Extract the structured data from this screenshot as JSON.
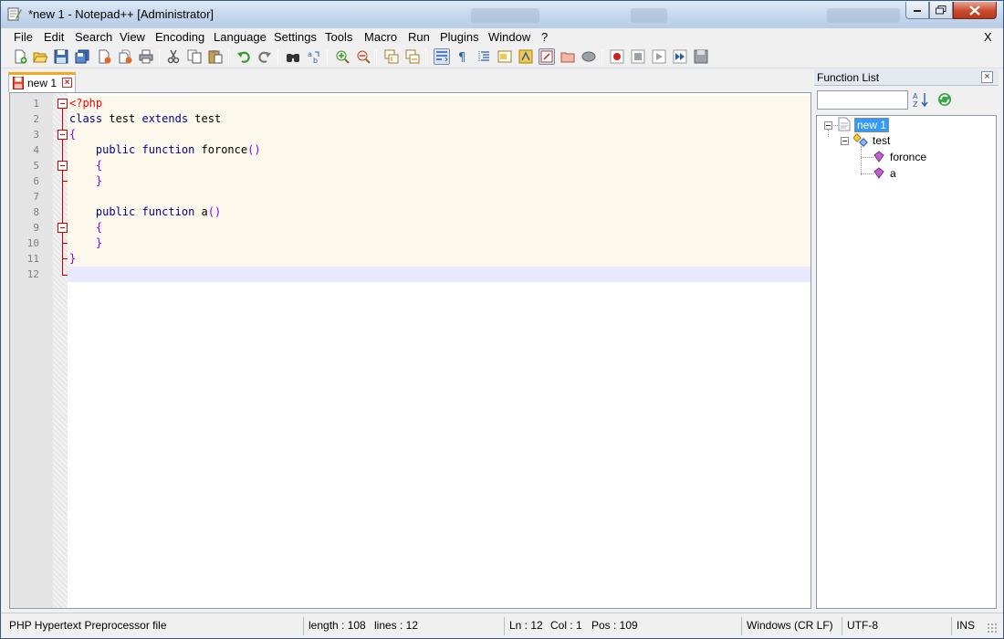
{
  "window": {
    "title": "*new 1 - Notepad++ [Administrator]",
    "icon": "notepadpp-icon"
  },
  "menu": {
    "items": [
      {
        "label": "File"
      },
      {
        "label": "Edit"
      },
      {
        "label": "Search"
      },
      {
        "label": "View"
      },
      {
        "label": "Encoding"
      },
      {
        "label": "Language"
      },
      {
        "label": "Settings"
      },
      {
        "label": "Tools"
      },
      {
        "label": "Macro"
      },
      {
        "label": "Run"
      },
      {
        "label": "Plugins"
      },
      {
        "label": "Window"
      },
      {
        "label": "?"
      }
    ],
    "close_label": "X"
  },
  "toolbar": {
    "buttons": [
      "new-file-icon",
      "open-file-icon",
      "save-icon",
      "save-all-icon",
      "close-icon",
      "close-all-icon",
      "print-icon",
      "cut-icon",
      "copy-icon",
      "paste-icon",
      "undo-icon",
      "redo-icon",
      "find-icon",
      "replace-icon",
      "zoom-in-icon",
      "zoom-out-icon",
      "sync-vertical-icon",
      "sync-horizontal-icon",
      "word-wrap-icon",
      "show-all-chars-icon",
      "indent-guide-icon",
      "doc-map-icon",
      "function-list-icon",
      "folder-workspace-icon",
      "monitoring-icon",
      "record-macro-icon",
      "stop-record-icon",
      "play-macro-icon",
      "run-macro-multiple-icon",
      "save-macro-icon"
    ]
  },
  "tabs": [
    {
      "label": "new 1",
      "modified": true,
      "active": true
    }
  ],
  "editor": {
    "line_numbers": [
      "1",
      "2",
      "3",
      "4",
      "5",
      "6",
      "7",
      "8",
      "9",
      "10",
      "11",
      "12"
    ],
    "current_line": 12,
    "colors": {
      "php_tag": "#ff0000",
      "keyword": "#00008b",
      "brace": "#8000ff",
      "fold_marker": "#cc0000",
      "caret_line": "#e8e8ff",
      "block_bg": "#fdf8ec"
    },
    "lines": [
      [
        {
          "t": "<?php",
          "c": "kw-php"
        }
      ],
      [
        {
          "t": "class",
          "c": "kw"
        },
        {
          "t": " test ",
          "c": "plain"
        },
        {
          "t": "extends",
          "c": "kw"
        },
        {
          "t": " test",
          "c": "plain"
        }
      ],
      [
        {
          "t": "{",
          "c": "brace"
        }
      ],
      [
        {
          "t": "    ",
          "c": "plain"
        },
        {
          "t": "public",
          "c": "kw"
        },
        {
          "t": " ",
          "c": "plain"
        },
        {
          "t": "function",
          "c": "kw"
        },
        {
          "t": " foronce",
          "c": "plain"
        },
        {
          "t": "()",
          "c": "brace"
        }
      ],
      [
        {
          "t": "    {",
          "c": "brace"
        }
      ],
      [
        {
          "t": "    }",
          "c": "brace"
        }
      ],
      [],
      [
        {
          "t": "    ",
          "c": "plain"
        },
        {
          "t": "public",
          "c": "kw"
        },
        {
          "t": " ",
          "c": "plain"
        },
        {
          "t": "function",
          "c": "kw"
        },
        {
          "t": " a",
          "c": "plain"
        },
        {
          "t": "()",
          "c": "brace"
        }
      ],
      [
        {
          "t": "    {",
          "c": "brace"
        }
      ],
      [
        {
          "t": "    }",
          "c": "brace"
        }
      ],
      [
        {
          "t": "}",
          "c": "brace"
        }
      ],
      []
    ]
  },
  "function_list": {
    "title": "Function List",
    "close_label": "×",
    "search_value": "",
    "tree": {
      "root": "new 1",
      "class": "test",
      "methods": [
        "foronce",
        "a"
      ]
    }
  },
  "status": {
    "file_type": "PHP Hypertext Preprocessor file",
    "length": "length : 108",
    "lines": "lines : 12",
    "ln": "Ln : 12",
    "col": "Col : 1",
    "pos": "Pos : 109",
    "eol": "Windows (CR LF)",
    "encoding": "UTF-8",
    "mode": "INS"
  }
}
